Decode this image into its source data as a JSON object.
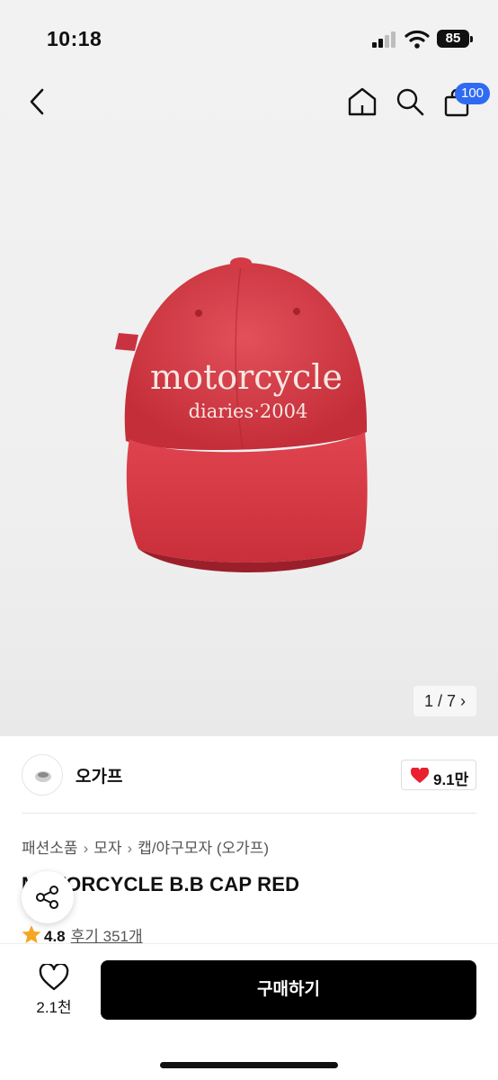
{
  "status_bar": {
    "time": "10:18",
    "battery": "85"
  },
  "nav": {
    "cart_badge": "100",
    "icons": [
      "back-icon",
      "home-icon",
      "search-icon",
      "shopping-bag-icon"
    ]
  },
  "product_image": {
    "cap_text_line1": "motorcycle",
    "cap_text_line2": "diaries·2004",
    "counter": "1 / 7",
    "cap_color": "#d63b45"
  },
  "brand": {
    "name": "오가프",
    "likes": "9.1만"
  },
  "breadcrumb": [
    "패션소품",
    "모자",
    "캡/야구모자 (오가프)"
  ],
  "product": {
    "title": "MOTORCYCLE B.B CAP RED",
    "title_visible": "M   ORCYCLE B.B CAP RED",
    "rating": "4.8",
    "reviews": "후기 351개"
  },
  "bottom_bar": {
    "wish_count": "2.1천",
    "buy_label": "구매하기"
  },
  "colors": {
    "accent_blue": "#2f6bf2",
    "heart_red": "#e8202f",
    "star": "#f5a623",
    "buy_bg": "#000000"
  }
}
